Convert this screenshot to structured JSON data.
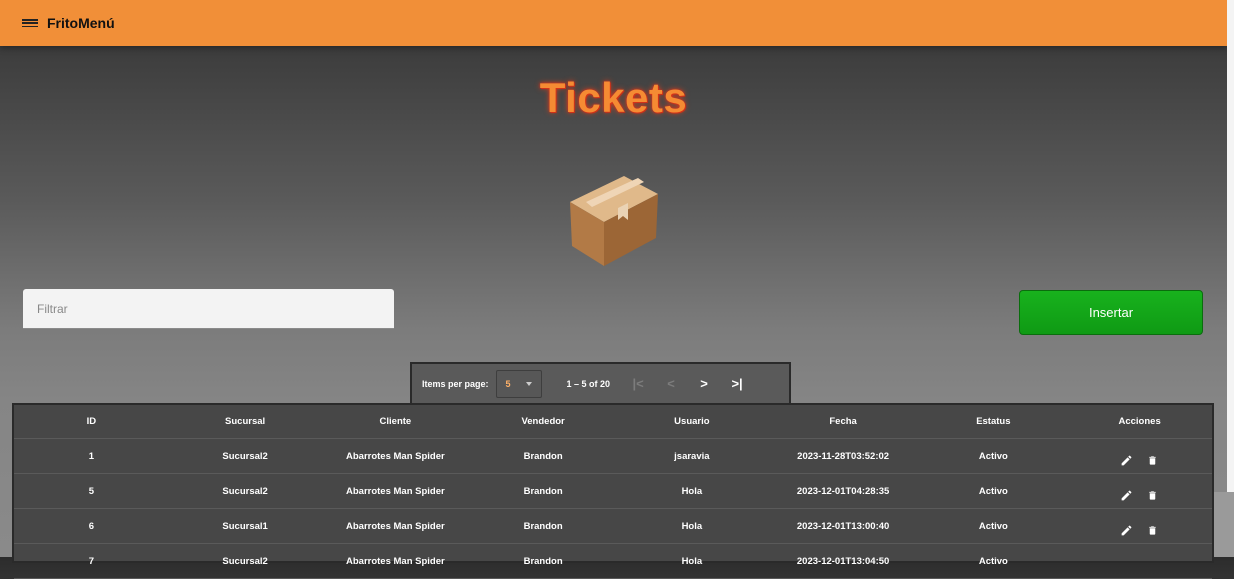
{
  "app": {
    "title": "FritoMenú",
    "menu_icon": "menu-icon"
  },
  "page": {
    "title": "Tickets",
    "hero_icon": "box-icon"
  },
  "filter": {
    "placeholder": "Filtrar",
    "value": ""
  },
  "insert_button": {
    "label": "Insertar",
    "color": "#13a818"
  },
  "paginator": {
    "items_per_page_label": "Items per page:",
    "page_size": "5",
    "range_label": "1 – 5 of 20",
    "first_glyph": "|<",
    "prev_glyph": "<",
    "next_glyph": ">",
    "last_glyph": ">|"
  },
  "table": {
    "columns": {
      "id": "ID",
      "sucursal": "Sucursal",
      "cliente": "Cliente",
      "vendedor": "Vendedor",
      "usuario": "Usuario",
      "fecha": "Fecha",
      "estatus": "Estatus",
      "acciones": "Acciones"
    },
    "rows": [
      {
        "id": "1",
        "sucursal": "Sucursal2",
        "cliente": "Abarrotes Man Spider",
        "vendedor": "Brandon",
        "usuario": "jsaravia",
        "fecha": "2023-11-28T03:52:02",
        "estatus": "Activo"
      },
      {
        "id": "5",
        "sucursal": "Sucursal2",
        "cliente": "Abarrotes Man Spider",
        "vendedor": "Brandon",
        "usuario": "Hola",
        "fecha": "2023-12-01T04:28:35",
        "estatus": "Activo"
      },
      {
        "id": "6",
        "sucursal": "Sucursal1",
        "cliente": "Abarrotes Man Spider",
        "vendedor": "Brandon",
        "usuario": "Hola",
        "fecha": "2023-12-01T13:00:40",
        "estatus": "Activo"
      },
      {
        "id": "7",
        "sucursal": "Sucursal2",
        "cliente": "Abarrotes Man Spider",
        "vendedor": "Brandon",
        "usuario": "Hola",
        "fecha": "2023-12-01T13:04:50",
        "estatus": "Activo"
      }
    ],
    "action_icons": [
      "edit-icon",
      "delete-icon"
    ]
  },
  "colors": {
    "toolbar": "#f18f38",
    "title": "#f58b33",
    "table_bg": "#474747"
  }
}
